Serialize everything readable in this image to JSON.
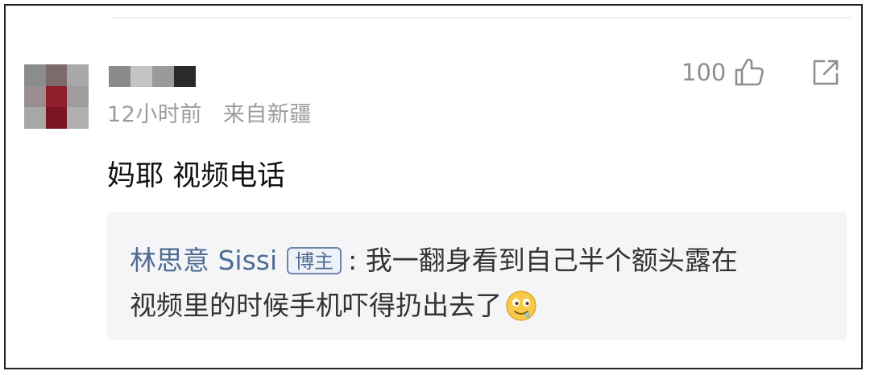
{
  "avatar": {
    "mosaic_colors": [
      "#8c8c8c",
      "#7d6a6d",
      "#a8a8a8",
      "#9a8e90",
      "#8e1f2b",
      "#a09c9e",
      "#a7a7a7",
      "#7a1420",
      "#b0b0b0"
    ]
  },
  "username_mosaic_colors": [
    "#8a8a8a",
    "#c4c4c4",
    "#9a9a9a",
    "#2a2a2a"
  ],
  "comment": {
    "time": "12小时前",
    "location": "来自新疆",
    "like_count": "100",
    "text": "妈耶 视频电话"
  },
  "reply": {
    "author": "林思意 Sissi",
    "badge": "博主",
    "separator": ":",
    "line1": "我一翻身看到自己半个额头露在",
    "line2": "视频里的时候手机吓得扔出去了",
    "emoji_icon": "drooling-face-emoji"
  },
  "colors": {
    "link_blue": "#4f6c94",
    "meta_gray": "#9c9c9c",
    "reply_bg": "#f5f5f7"
  }
}
